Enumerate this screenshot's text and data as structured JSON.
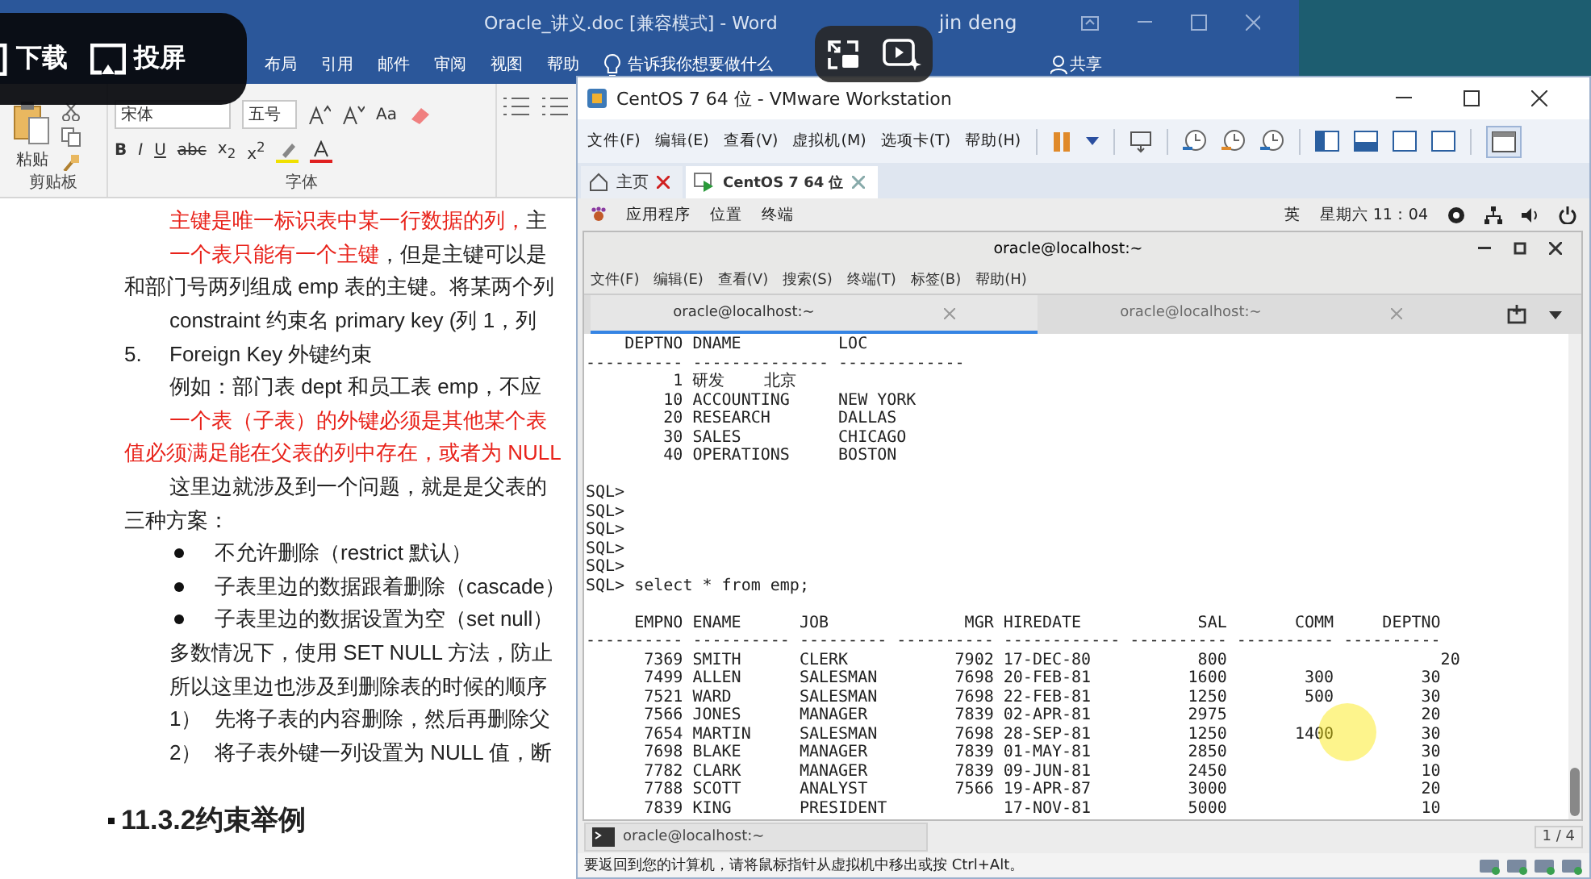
{
  "word": {
    "title": "Oracle_讲义.doc [兼容模式]  -  Word",
    "user": "jin deng",
    "ribbon_tabs": [
      {
        "label": "布局"
      },
      {
        "label": "引用"
      },
      {
        "label": "邮件"
      },
      {
        "label": "审阅"
      },
      {
        "label": "视图"
      },
      {
        "label": "帮助"
      }
    ],
    "tell_me": "告诉我你想要做什么",
    "share": "共享",
    "ribbon": {
      "paste": "粘贴",
      "clipboard_label": "剪贴板",
      "font": "宋体",
      "font_size": "五号",
      "case_button": "Aa",
      "format_buttons": [
        "B",
        "I",
        "U",
        "abc",
        "x$_{2}$",
        "x$^{2}$"
      ],
      "font_label": "字体"
    },
    "document": {
      "lines": [
        {
          "kind": "indent",
          "segments": [
            {
              "text": "主键是唯一标识表中某一行数据的列，",
              "highlighted": true
            },
            {
              "text": "主",
              "highlighted": false
            }
          ]
        },
        {
          "kind": "indent",
          "segments": [
            {
              "text": "一个表只能有一个主键",
              "highlighted": true
            },
            {
              "text": "，但是主键可以是",
              "highlighted": false
            }
          ]
        },
        {
          "kind": "flush",
          "segments": [
            {
              "text": "和部门号两列组成 emp 表的主键。将某两个列",
              "highlighted": false
            }
          ]
        },
        {
          "kind": "indent",
          "segments": [
            {
              "text": "constraint  约束名  primary key (列 1，列",
              "highlighted": false
            }
          ]
        },
        {
          "kind": "numbered",
          "marker": "5.",
          "text": "Foreign Key   外键约束"
        },
        {
          "kind": "indent",
          "segments": [
            {
              "text": "例如：部门表 dept 和员工表 emp，不应",
              "highlighted": false
            }
          ]
        },
        {
          "kind": "indent",
          "segments": [
            {
              "text": "一个表（子表）的外键必须是其他某个表",
              "highlighted": true
            }
          ]
        },
        {
          "kind": "flush",
          "segments": [
            {
              "text": "值必须满足能在父表的列中存在，或者为 NULL",
              "highlighted": true
            }
          ]
        },
        {
          "kind": "indent",
          "segments": [
            {
              "text": "这里边就涉及到一个问题，就是是父表的",
              "highlighted": false
            }
          ]
        },
        {
          "kind": "flush",
          "segments": [
            {
              "text": "三种方案：",
              "highlighted": false
            }
          ]
        },
        {
          "kind": "bullet",
          "text": "不允许删除（restrict 默认）"
        },
        {
          "kind": "bullet",
          "text": "子表里边的数据跟着删除（cascade）"
        },
        {
          "kind": "bullet",
          "text": "子表里边的数据设置为空（set null）"
        },
        {
          "kind": "indent",
          "segments": [
            {
              "text": "多数情况下，使用 SET NULL 方法，防止",
              "highlighted": false
            }
          ]
        },
        {
          "kind": "indent",
          "segments": [
            {
              "text": "所以这里边也涉及到删除表的时候的顺序",
              "highlighted": false
            }
          ]
        },
        {
          "kind": "step",
          "marker": "1）",
          "text": "先将子表的内容删除，然后再删除父"
        },
        {
          "kind": "step",
          "marker": "2）",
          "text": "将子表外键一列设置为 NULL 值，断"
        }
      ],
      "heading": "11.3.2约束举例"
    }
  },
  "player_overlay": {
    "buttons": [
      {
        "label": "下载"
      },
      {
        "label": "投屏"
      }
    ]
  },
  "vmware": {
    "title": "CentOS 7 64 位 - VMware Workstation",
    "menu": [
      "文件(F)",
      "编辑(E)",
      "查看(V)",
      "虚拟机(M)",
      "选项卡(T)",
      "帮助(H)"
    ],
    "tabs": [
      {
        "label": "主页",
        "kind": "home",
        "selected": false
      },
      {
        "label": "CentOS 7 64 位",
        "kind": "vm",
        "selected": true
      }
    ],
    "guest_bar": {
      "menus": [
        "应用程序",
        "位置",
        "终端"
      ],
      "input_method": "英",
      "clock": "星期六 11：04"
    },
    "terminal": {
      "title": "oracle@localhost:~",
      "menu": [
        "文件(F)",
        "编辑(E)",
        "查看(V)",
        "搜索(S)",
        "终端(T)",
        "标签(B)",
        "帮助(H)"
      ],
      "tabs": [
        {
          "label": "oracle@localhost:~",
          "selected": true
        },
        {
          "label": "oracle@localhost:~",
          "selected": false
        }
      ],
      "blocks": [
        [
          "    DEPTNO DNAME          LOC",
          "---------- -------------- -------------",
          "         1 研发    北京",
          "        10 ACCOUNTING     NEW YORK",
          "        20 RESEARCH       DALLAS",
          "        30 SALES          CHICAGO",
          "        40 OPERATIONS     BOSTON"
        ],
        [
          "SQL>",
          "SQL>",
          "SQL>",
          "SQL>",
          "SQL>",
          "SQL> select * from emp;"
        ],
        [
          "     EMPNO ENAME      JOB              MGR HIREDATE            SAL       COMM     DEPTNO",
          "---------- ---------- --------- ---------- ------------ ---------- ---------- ----------",
          "      7369 SMITH      CLERK           7902 17-DEC-80           800                      20",
          "      7499 ALLEN      SALESMAN        7698 20-FEB-81          1600        300         30",
          "      7521 WARD       SALESMAN        7698 22-FEB-81          1250        500         30",
          "      7566 JONES      MANAGER         7839 02-APR-81          2975                    20",
          "      7654 MARTIN     SALESMAN        7698 28-SEP-81          1250       1400         30",
          "      7698 BLAKE      MANAGER         7839 01-MAY-81          2850                    30",
          "      7782 CLARK      MANAGER         7839 09-JUN-81          2450                    10",
          "      7788 SCOTT      ANALYST         7566 19-APR-87          3000                    20",
          "      7839 KING       PRESIDENT            17-NOV-81          5000                    10"
        ]
      ]
    },
    "taskbar": {
      "window": "oracle@localhost:~",
      "workspace": "1 / 4"
    },
    "status": "要返回到您的计算机，请将鼠标指针从虚拟机中移出或按 Ctrl+Alt。"
  }
}
